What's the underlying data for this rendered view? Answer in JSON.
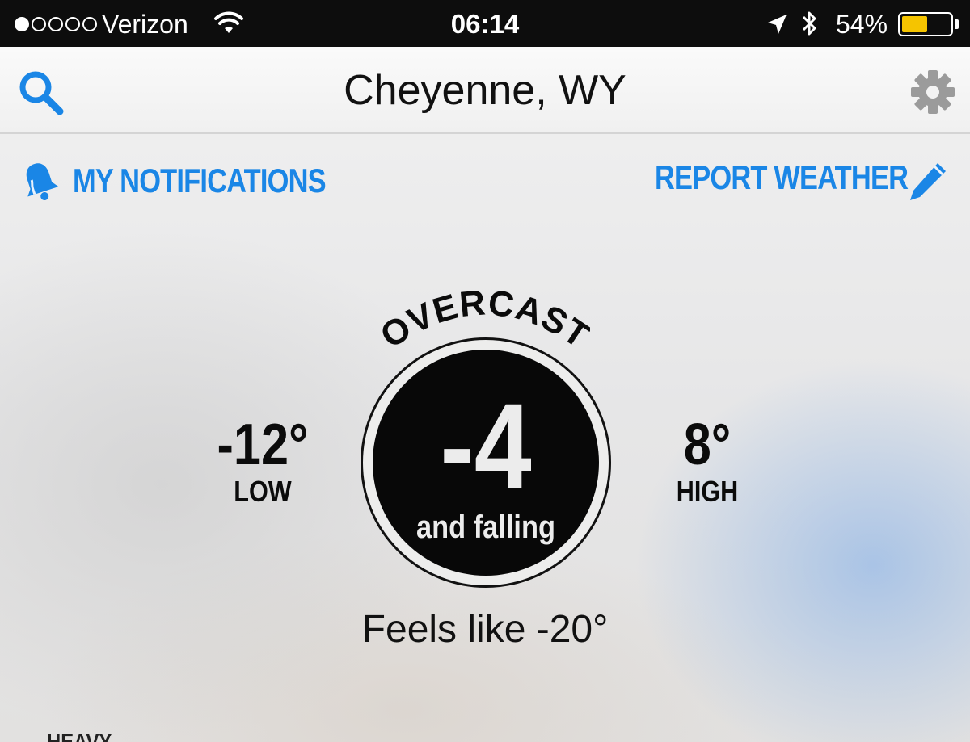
{
  "status_bar": {
    "carrier": "Verizon",
    "signal_bars_filled": 1,
    "signal_bars_total": 5,
    "time": "06:14",
    "battery_percent": "54%",
    "battery_level": 0.54,
    "battery_color": "#f5c400",
    "icons": [
      "wifi-icon",
      "location-arrow-icon",
      "bluetooth-icon",
      "battery-icon"
    ]
  },
  "nav": {
    "title": "Cheyenne, WY",
    "search_icon": "search-icon",
    "settings_icon": "gear-icon"
  },
  "actions": {
    "notifications_label": "MY NOTIFICATIONS",
    "notifications_icon": "bell-icon",
    "report_label": "REPORT WEATHER",
    "report_icon": "pencil-icon",
    "accent_color": "#1a86e6"
  },
  "weather": {
    "condition": "OVERCAST",
    "current_temp": "-4",
    "trend": "and falling",
    "low_value": "-12°",
    "low_label": "LOW",
    "high_value": "8°",
    "high_label": "HIGH",
    "feels_like": "Feels like -20°"
  },
  "precip": {
    "label": "HEAVY"
  }
}
